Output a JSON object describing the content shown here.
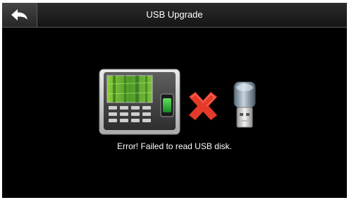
{
  "header": {
    "title": "USB Upgrade",
    "back_icon": "back-arrow-icon"
  },
  "main": {
    "message": "Error! Failed to read USB disk.",
    "icons": [
      "attendance-terminal-icon",
      "error-x-icon",
      "usb-drive-icon"
    ]
  },
  "colors": {
    "background": "#000000",
    "header": "#1e1e1e",
    "error_red": "#e53a2a",
    "text": "#ffffff"
  }
}
